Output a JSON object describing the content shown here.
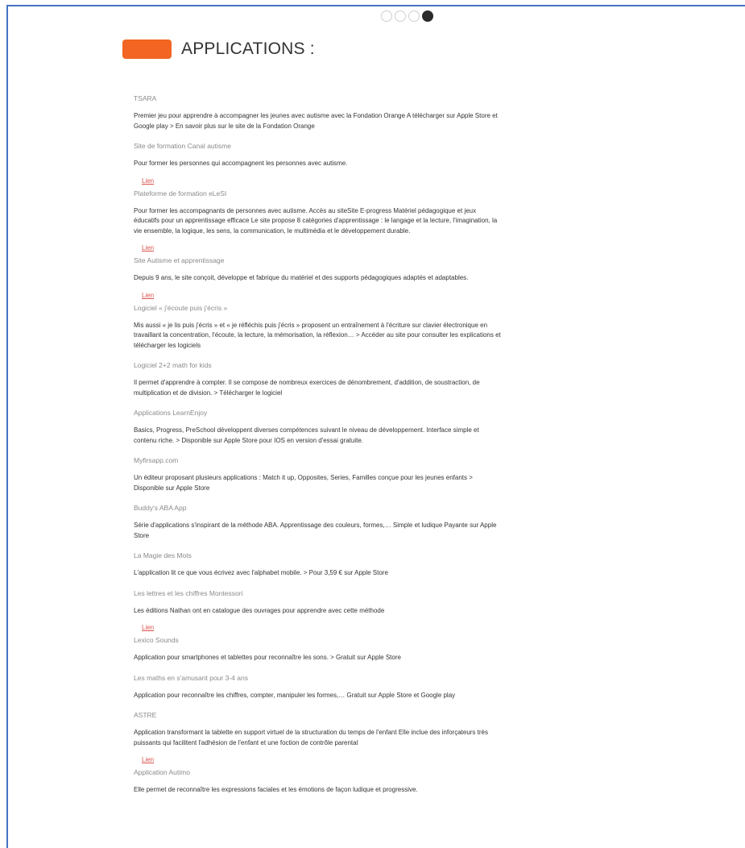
{
  "header": {
    "title": "APPLICATIONS :"
  },
  "pager": {
    "pages": 4,
    "active": 4
  },
  "colors": {
    "accent": "#f26522",
    "link": "#d9534f",
    "frame": "#4472c4"
  },
  "entries": [
    {
      "title": "TSARA",
      "desc": "Premier jeu pour apprendre à accompagner les jeunes avec autisme avec la Fondation Orange A télécharger sur Apple Store et Google play > En savoir plus sur le site de la Fondation Orange",
      "link": ""
    },
    {
      "title": "Site de formation Canal autisme",
      "desc": "Pour former les personnes qui accompagnent les personnes avec autisme.",
      "link": "Lien"
    },
    {
      "title": "Plateforme de formation eLeSI",
      "desc": "Pour former les accompagnants de personnes avec autisme. Accès au siteSite E-progress Matériel pédagogique et jeux éducatifs pour un apprentissage efficace Le site propose 8 catégories d'apprentissage : le langage et la lecture, l'imagination, la vie ensemble, la logique, les sens, la communication, le multimédia et le développement durable.",
      "link": "Lien"
    },
    {
      "title": "Site Autisme et apprentissage",
      "desc": "Depuis 9 ans, le site conçoit, développe et fabrique du matériel et des supports pédagogiques adaptés et adaptables.",
      "link": "Lien"
    },
    {
      "title": "Logiciel « j'écoute puis j'écris »",
      "desc": "Mis aussi « je lis puis j'écris » et « je réfléchis puis j'écris » proposent un entraînement à l'écriture sur clavier électronique en travaillant la concentration, l'écoute, la lecture, la mémorisation, la réflexion… > Accéder au site pour consulter les explications et télécharger les logiciels",
      "link": ""
    },
    {
      "title": "Logiciel 2+2 math for kids",
      "desc": "Il permet d'apprendre à compter. Il se compose de nombreux exercices de dénombrement, d'addition, de soustraction, de multiplication et de division. > Télécharger le logiciel",
      "link": ""
    },
    {
      "title": "Applications LearnEnjoy",
      "desc": "Basics, Progress, PreSchool développent diverses compétences suivant le niveau de développement. Interface simple et contenu riche. > Disponible sur Apple Store pour IOS en version d'essai gratuite.",
      "link": ""
    },
    {
      "title": "Myfirsapp.com",
      "desc": "Un éditeur proposant plusieurs applications : Match it up, Opposites, Series, Familles conçue pour les jeunes enfants > Disponible sur Apple Store",
      "link": ""
    },
    {
      "title": "Buddy's ABA App",
      "desc": "Série d'applications s'inspirant de la méthode ABA. Apprentissage des couleurs, formes,… Simple et ludique Payante sur Apple Store",
      "link": ""
    },
    {
      "title": "La Magie des Mots",
      "desc": "L'application lit ce que vous écrivez avec l'alphabet mobile. > Pour 3,59 € sur Apple Store",
      "link": ""
    },
    {
      "title": "Les lettres et les chiffres Montessori",
      "desc": "Les éditions Nathan ont en catalogue des ouvrages pour apprendre avec cette méthode",
      "link": "Lien"
    },
    {
      "title": "Lexico Sounds",
      "desc": "Application pour smartphones et tablettes pour reconnaître les sons. > Gratuit sur Apple Store",
      "link": ""
    },
    {
      "title": "Les maths en s'amusant pour 3-4 ans",
      "desc": "Application pour reconnaître les chiffres, compter, manipuler les formes,… Gratuit sur Apple Store et Google play",
      "link": ""
    },
    {
      "title": "ASTRE",
      "desc": "Application transformant la tablette en support virtuel de la structuration du temps de l'enfant Elle inclue des inforçateurs très puissants qui facilitent l'adhésion de l'enfant et une foction de contrôle parental",
      "link": "Lien"
    },
    {
      "title": "Application Autimo",
      "desc": "Elle permet de reconnaître les expressions faciales et les émotions de façon ludique et progressive.",
      "link": ""
    }
  ]
}
